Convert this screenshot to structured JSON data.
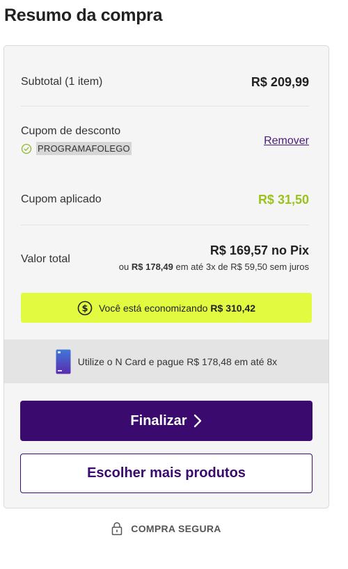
{
  "title": "Resumo da compra",
  "subtotal": {
    "label": "Subtotal (1 item)",
    "value": "R$ 209,99"
  },
  "coupon": {
    "label": "Cupom de desconto",
    "code": "PROGRAMAFOLEGO",
    "remove_label": "Remover"
  },
  "applied": {
    "label": "Cupom aplicado",
    "value": "R$ 31,50"
  },
  "total": {
    "label": "Valor total",
    "pix": "R$ 169,57 no Pix",
    "prefix": "ou",
    "amount": "R$ 178,49",
    "suffix": "em até 3x de R$ 59,50 sem juros"
  },
  "savings": {
    "text": "Você está economizando",
    "amount": "R$ 310,42"
  },
  "ncard": {
    "text": "Utilize o N Card e pague R$ 178,48 em até 8x"
  },
  "actions": {
    "primary_label": "Finalizar",
    "secondary_label": "Escolher mais produtos"
  },
  "secure": {
    "label": "COMPRA SEGURA"
  },
  "colors": {
    "primary": "#3a0a6e",
    "accent": "#e2fb41",
    "discount": "#9bc21b",
    "success_icon": "#8cb82a"
  },
  "icons": [
    "check-circle-icon",
    "dollar-circle-icon",
    "n-card-icon",
    "chevron-right-icon",
    "lock-icon"
  ]
}
